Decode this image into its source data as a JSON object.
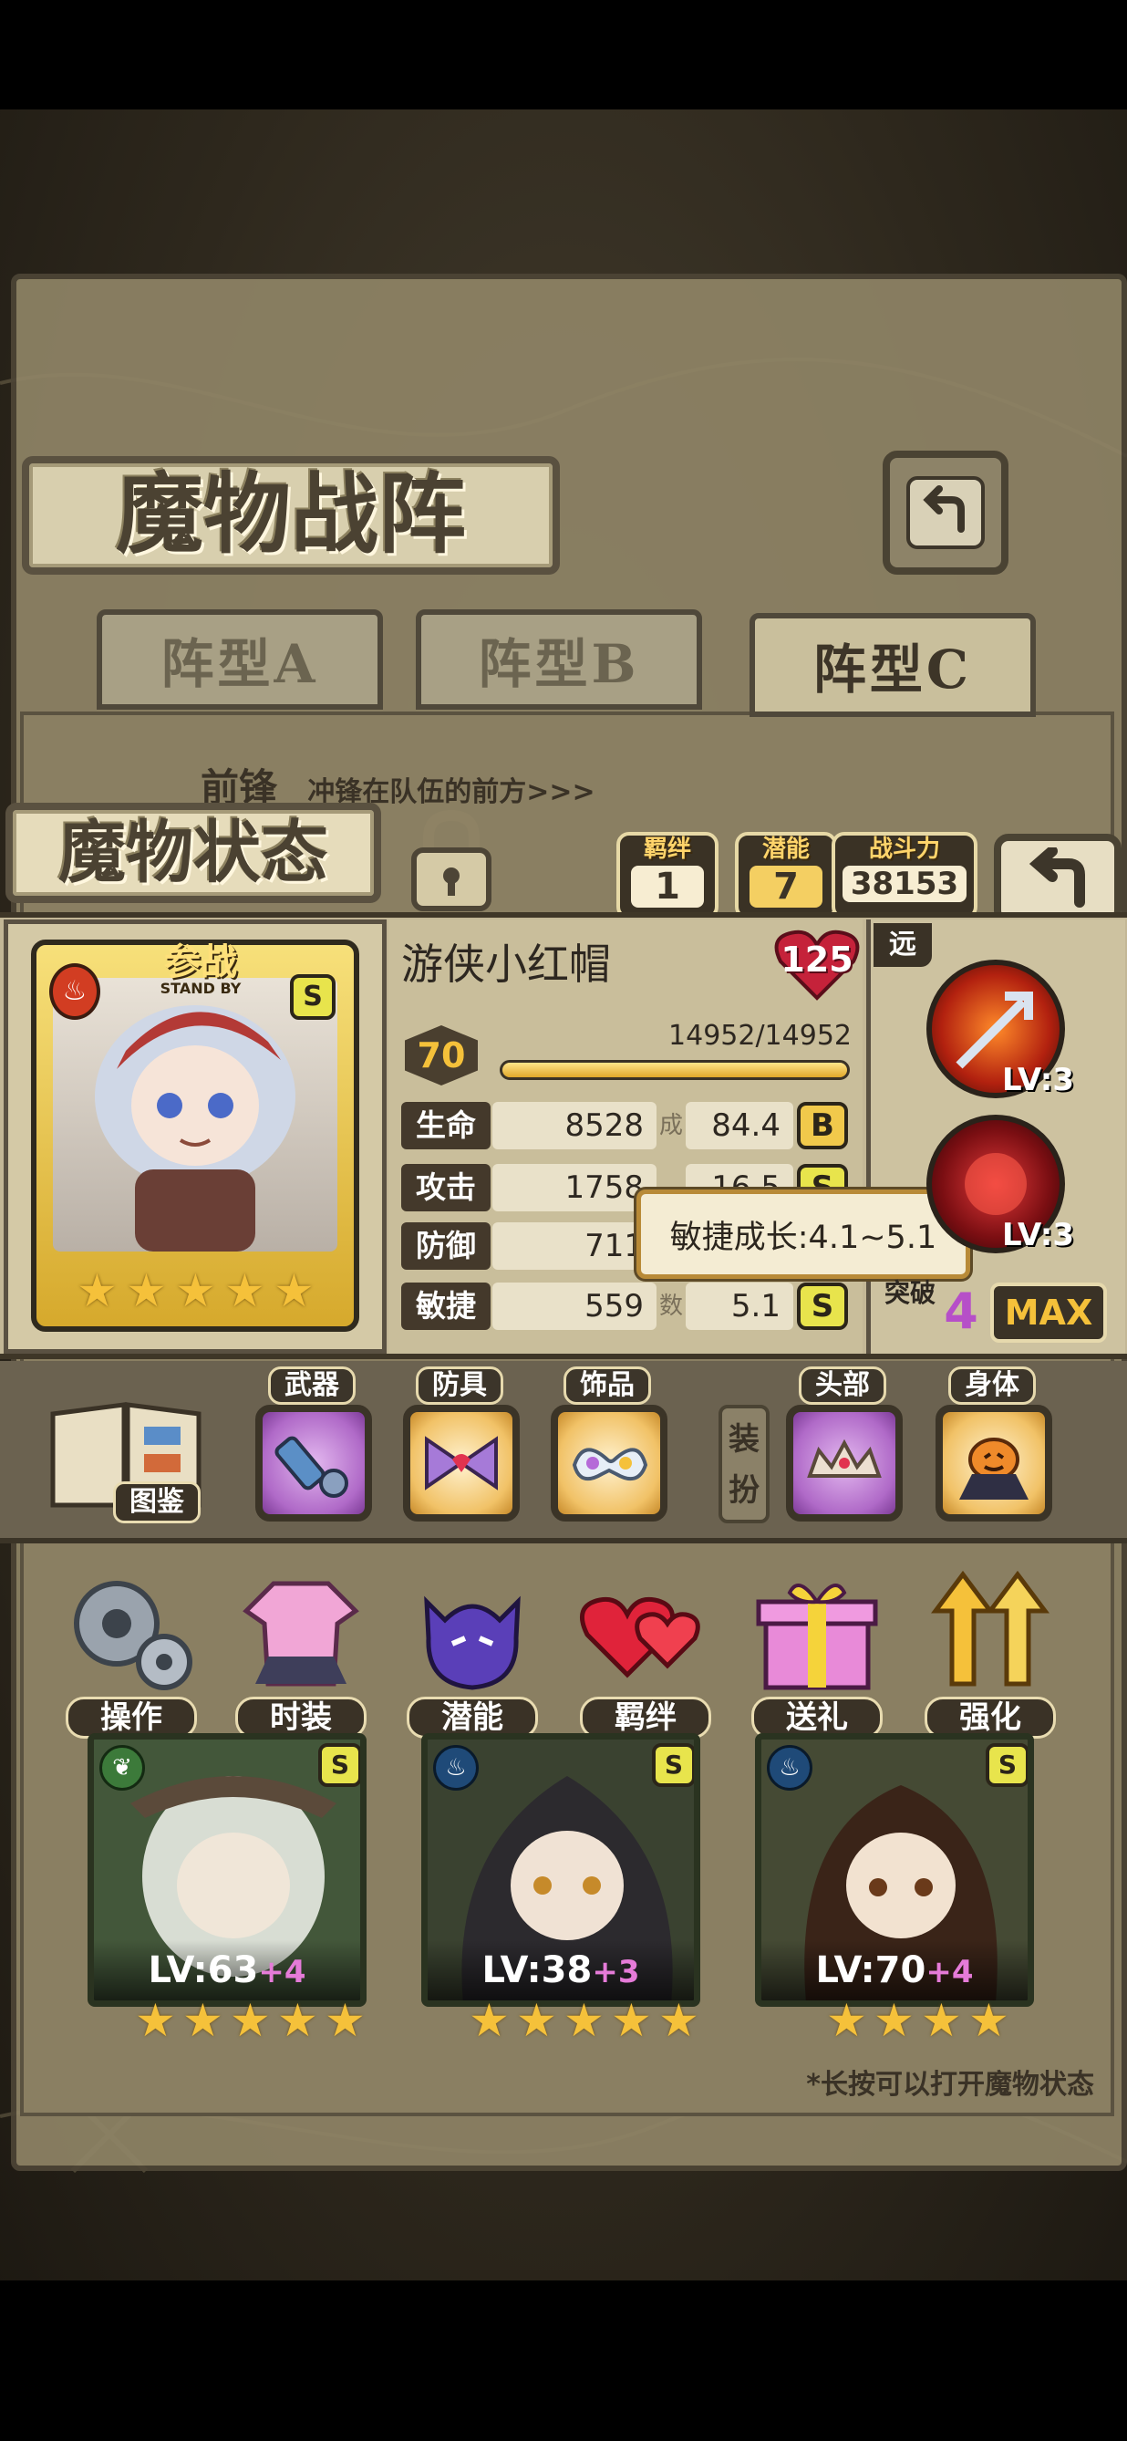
{
  "title": "魔物战阵",
  "tabs": [
    {
      "label": "阵型A",
      "active": false
    },
    {
      "label": "阵型B",
      "active": false
    },
    {
      "label": "阵型C",
      "active": true
    }
  ],
  "front_row": {
    "label": "前锋",
    "hint": "冲锋在队伍的前方>>>"
  },
  "status": {
    "title": "魔物状态",
    "bond_label": "羁绊",
    "bond_value": "1",
    "potential_label": "潜能",
    "potential_value": "7",
    "power_label": "战斗力",
    "power_value": "38153",
    "standby_label": "参战",
    "standby_sub": "STAND BY",
    "grade_badge": "S",
    "stars": 5,
    "name": "游侠小红帽",
    "rank": "125",
    "range_label": "远",
    "level": "70",
    "hp_text": "14952/14952",
    "hp_fraction": 1.0,
    "stats": [
      {
        "name": "生命",
        "value": "8528",
        "side": "成",
        "growth": "84.4",
        "grade": "B"
      },
      {
        "name": "攻击",
        "value": "1758",
        "side": "",
        "growth": "16.5",
        "grade": "S"
      },
      {
        "name": "防御",
        "value": "711",
        "side": "",
        "growth": "",
        "grade": ""
      },
      {
        "name": "敏捷",
        "value": "559",
        "side": "数",
        "growth": "5.1",
        "grade": "S"
      }
    ],
    "tooltip": "敏捷成长:4.1~5.1",
    "skills": [
      {
        "icon": "arrow-fire-skill-icon",
        "level": "LV:3"
      },
      {
        "icon": "red-orb-skill-icon",
        "level": "LV:3"
      }
    ],
    "breakthrough_label": "突破",
    "breakthrough_value": "4",
    "max_label": "MAX"
  },
  "equipment": {
    "codex_label": "图鉴",
    "dress_label": "装扮",
    "slots": [
      {
        "label": "武器",
        "icon": "blaster-weapon-icon"
      },
      {
        "label": "防具",
        "icon": "bow-armor-icon"
      },
      {
        "label": "饰品",
        "icon": "mask-accessory-icon"
      },
      {
        "label": "头部",
        "icon": "tiara-head-icon"
      },
      {
        "label": "身体",
        "icon": "pumpkin-body-icon"
      }
    ]
  },
  "functions": [
    {
      "label": "操作",
      "icon": "gears-icon"
    },
    {
      "label": "时装",
      "icon": "dress-icon"
    },
    {
      "label": "潜能",
      "icon": "demon-icon"
    },
    {
      "label": "羁绊",
      "icon": "hearts-icon"
    },
    {
      "label": "送礼",
      "icon": "gift-icon"
    },
    {
      "label": "强化",
      "icon": "up-arrows-icon"
    }
  ],
  "monsters": [
    {
      "lv": "LV:63",
      "plus": "+4",
      "grade": "S",
      "stars": 5
    },
    {
      "lv": "LV:38",
      "plus": "+3",
      "grade": "S",
      "stars": 5
    },
    {
      "lv": "LV:70",
      "plus": "+4",
      "grade": "S",
      "stars": 4
    }
  ],
  "footer_hint": "*长按可以打开魔物状态",
  "colors": {
    "accent_gold": "#f5c13a",
    "panel_dark": "#3a3226",
    "grade_pink": "#e57bd8"
  }
}
